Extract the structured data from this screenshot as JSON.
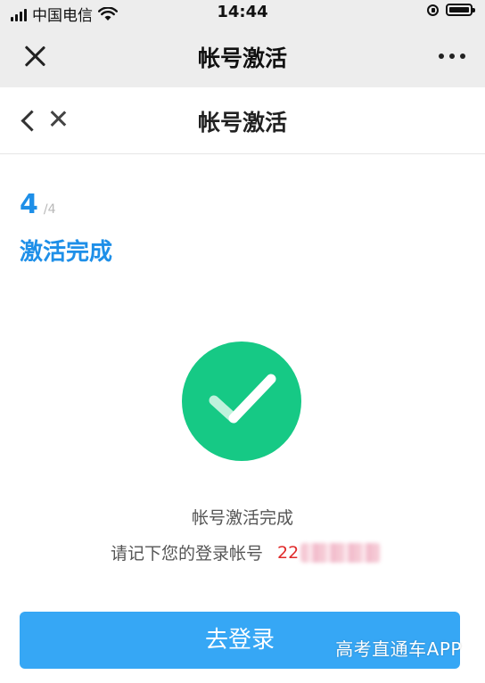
{
  "status_bar": {
    "carrier": "中国电信",
    "time": "14:44",
    "icons": [
      "signal-icon",
      "wifi-icon",
      "orientation-lock-icon",
      "battery-icon"
    ]
  },
  "wechat_bar": {
    "title": "帐号激活",
    "icons": [
      "close-icon",
      "more-icon"
    ]
  },
  "header": {
    "title": "帐号激活",
    "icons": [
      "back-icon",
      "close-icon"
    ]
  },
  "step": {
    "current": "4",
    "total": "/4",
    "label": "激活完成"
  },
  "result": {
    "done_text": "帐号激活完成",
    "account_prompt": "请记下您的登录帐号",
    "account_value": "22",
    "icon": "checkmark-icon"
  },
  "actions": {
    "login_label": "去登录"
  },
  "watermark": "高考直通车APP",
  "colors": {
    "accent": "#1e8fe8",
    "button": "#36a7f5",
    "success": "#16c985",
    "account": "#e02a2a"
  }
}
